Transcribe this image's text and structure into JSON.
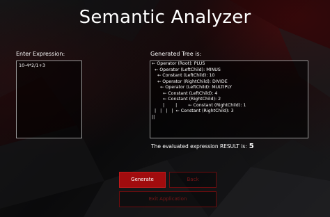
{
  "window": {
    "title": "Semantic Analyzer"
  },
  "expression": {
    "label": "Enter Expression:",
    "value": "10-4*2/1+3"
  },
  "tree": {
    "label": "Generated Tree is:",
    "lines": [
      "← Operator (Root): PLUS",
      "  ← Operator (LeftChild): MINUS",
      "    ← Constant (LeftChild): 10",
      "    ← Operator (RightChild): DIVIDE",
      "      ← Operator (LeftChild): MULTIPLY",
      "        ← Constant (LeftChild): 4",
      "        ← Constant (RightChild): 2",
      "        |        |        ← Constant (RightChild): 1",
      "  |   |   |   |  ← Constant (RightChild): 3",
      "||"
    ]
  },
  "result": {
    "label": "The evaluated expression RESULT is:",
    "value": "5"
  },
  "buttons": {
    "generate": "Generate",
    "back": "Back",
    "exit": "Exit Application"
  },
  "colors": {
    "accent": "#a10c0e",
    "disabled_text": "#7a1618",
    "background": "#0b0b0c"
  }
}
